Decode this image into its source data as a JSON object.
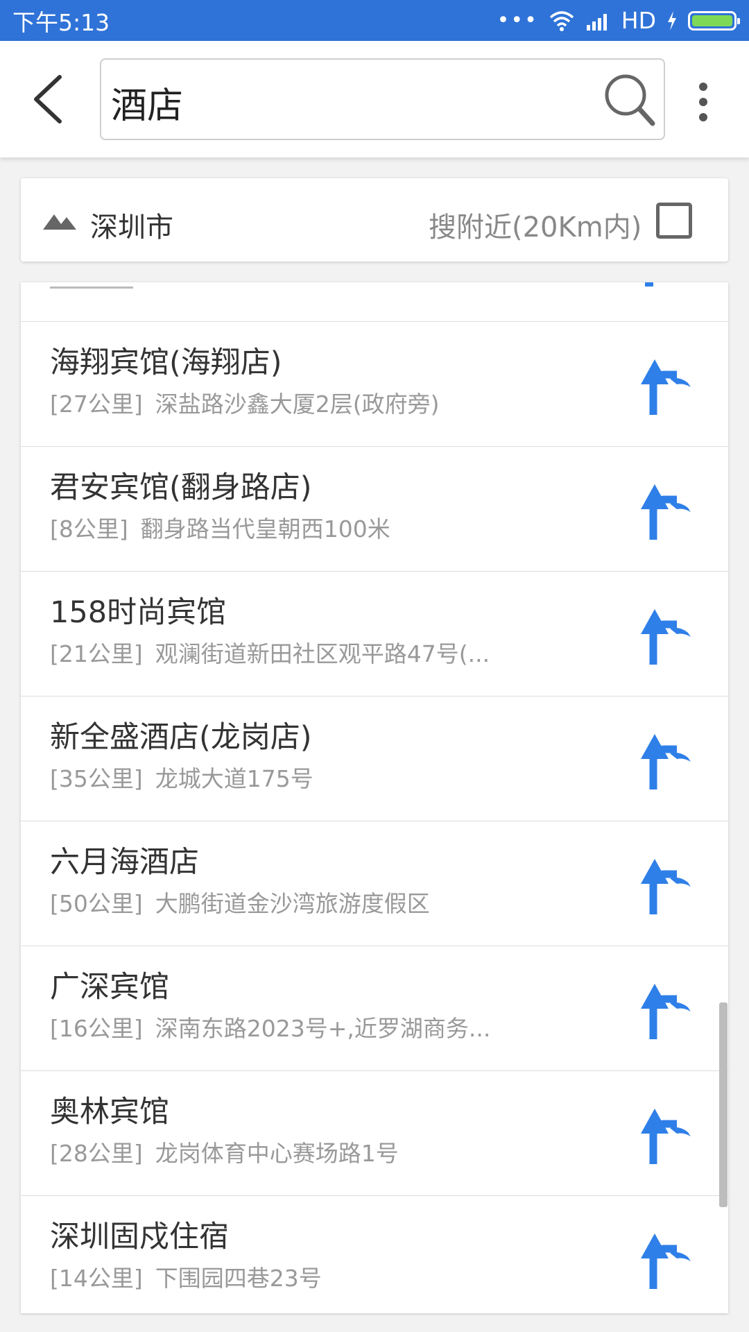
{
  "status_bar": {
    "time": "下午5:13",
    "dots": "•••",
    "network": "HD"
  },
  "search": {
    "query": "酒店",
    "icon": "search-icon"
  },
  "filter": {
    "city": "深圳市",
    "nearby_label": "搜附近(20Km内)",
    "nearby_checked": false
  },
  "results": [
    {
      "name": "海翔宾馆(海翔店)",
      "distance": "[27公里]",
      "address": "深盐路沙鑫大厦2层(政府旁)"
    },
    {
      "name": "君安宾馆(翻身路店)",
      "distance": "[8公里]",
      "address": "翻身路当代皇朝西100米"
    },
    {
      "name": "158时尚宾馆",
      "distance": "[21公里]",
      "address": "观澜街道新田社区观平路47号(..."
    },
    {
      "name": "新全盛酒店(龙岗店)",
      "distance": "[35公里]",
      "address": "龙城大道175号"
    },
    {
      "name": "六月海酒店",
      "distance": "[50公里]",
      "address": "大鹏街道金沙湾旅游度假区"
    },
    {
      "name": "广深宾馆",
      "distance": "[16公里]",
      "address": "深南东路2023号+,近罗湖商务..."
    },
    {
      "name": "奥林宾馆",
      "distance": "[28公里]",
      "address": "龙岗体育中心赛场路1号"
    },
    {
      "name": "深圳固戍住宿",
      "distance": "[14公里]",
      "address": "下围园四巷23号"
    }
  ],
  "colors": {
    "status_bar": "#2f73d8",
    "nav_arrow": "#2f7fe8",
    "battery": "#7ed957"
  }
}
